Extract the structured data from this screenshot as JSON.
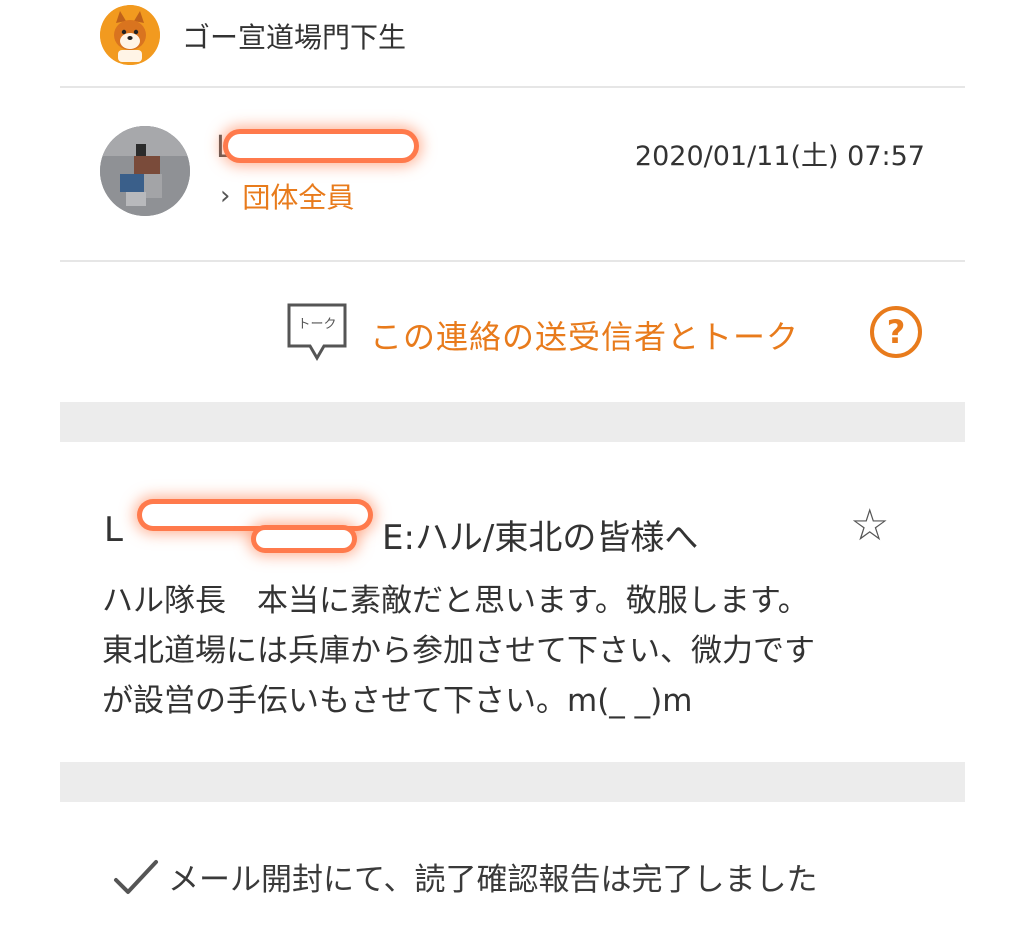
{
  "group": {
    "name": "ゴー宣道場門下生",
    "avatar_icon": "shiba-dog-icon"
  },
  "sender": {
    "name_visible": "L",
    "recipient_label": "団体全員",
    "sent_at": "2020/01/11(土) 07:57"
  },
  "talk": {
    "icon_label": "トーク",
    "label": "この連絡の送受信者とトーク",
    "help_symbol": "?"
  },
  "message": {
    "subject_prefix": "L",
    "subject_suffix": "E:ハル/東北の皆様へ",
    "body": "ハル隊長　本当に素敵だと思います。敬服します。\n東北道場には兵庫から参加させて下さい、微力です\nが設営の手伝いもさせて下さい。m(_ _)m"
  },
  "footer": {
    "read_confirmation": "メール開封にて、読了確認報告は完了しました"
  },
  "colors": {
    "accent": "#e87b1c",
    "divider": "#e6e6e6",
    "band": "#ececec"
  }
}
